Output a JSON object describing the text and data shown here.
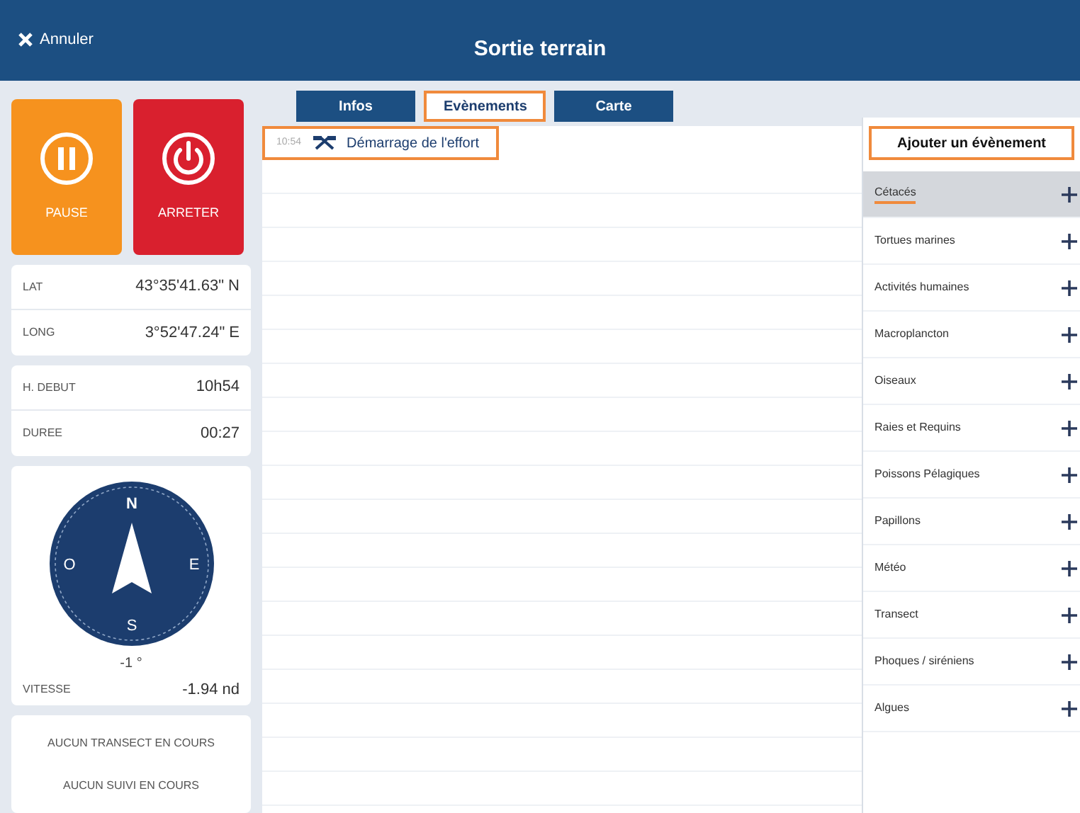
{
  "nav": {
    "cancel": "Annuler",
    "title": "Sortie terrain"
  },
  "controls": [
    {
      "kind": "pause",
      "label": "PAUSE"
    },
    {
      "kind": "stop",
      "label": "ARRETER"
    }
  ],
  "position": [
    {
      "label": "LAT",
      "value": "43°35'41.63\" N"
    },
    {
      "label": "LONG",
      "value": "3°52'47.24\" E"
    }
  ],
  "timing": [
    {
      "label": "H. DEBUT",
      "value": "10h54"
    },
    {
      "label": "DUREE",
      "value": "00:27"
    }
  ],
  "compass": {
    "north": "N",
    "east": "E",
    "south": "S",
    "west": "O",
    "heading": "-1 °"
  },
  "speed": {
    "label": "VITESSE",
    "value": "-1.94 nd"
  },
  "status_messages": [
    "AUCUN TRANSECT EN COURS",
    "AUCUN SUIVI EN COURS"
  ],
  "tabs": [
    {
      "label": "Infos",
      "selected": false
    },
    {
      "label": "Evènements",
      "selected": true
    },
    {
      "label": "Carte",
      "selected": false
    }
  ],
  "events": [
    {
      "time": "10:54",
      "label": "Démarrage de l'effort",
      "selected": true
    }
  ],
  "add_event": {
    "title": "Ajouter un évènement"
  },
  "categories": [
    {
      "label": "Cétacés",
      "selected": true
    },
    {
      "label": "Tortues marines",
      "selected": false
    },
    {
      "label": "Activités humaines",
      "selected": false
    },
    {
      "label": "Macroplancton",
      "selected": false
    },
    {
      "label": "Oiseaux",
      "selected": false
    },
    {
      "label": "Raies et Requins",
      "selected": false
    },
    {
      "label": "Poissons Pélagiques",
      "selected": false
    },
    {
      "label": "Papillons",
      "selected": false
    },
    {
      "label": "Météo",
      "selected": false
    },
    {
      "label": "Transect",
      "selected": false
    },
    {
      "label": "Phoques / siréniens",
      "selected": false
    },
    {
      "label": "Algues",
      "selected": false
    }
  ]
}
